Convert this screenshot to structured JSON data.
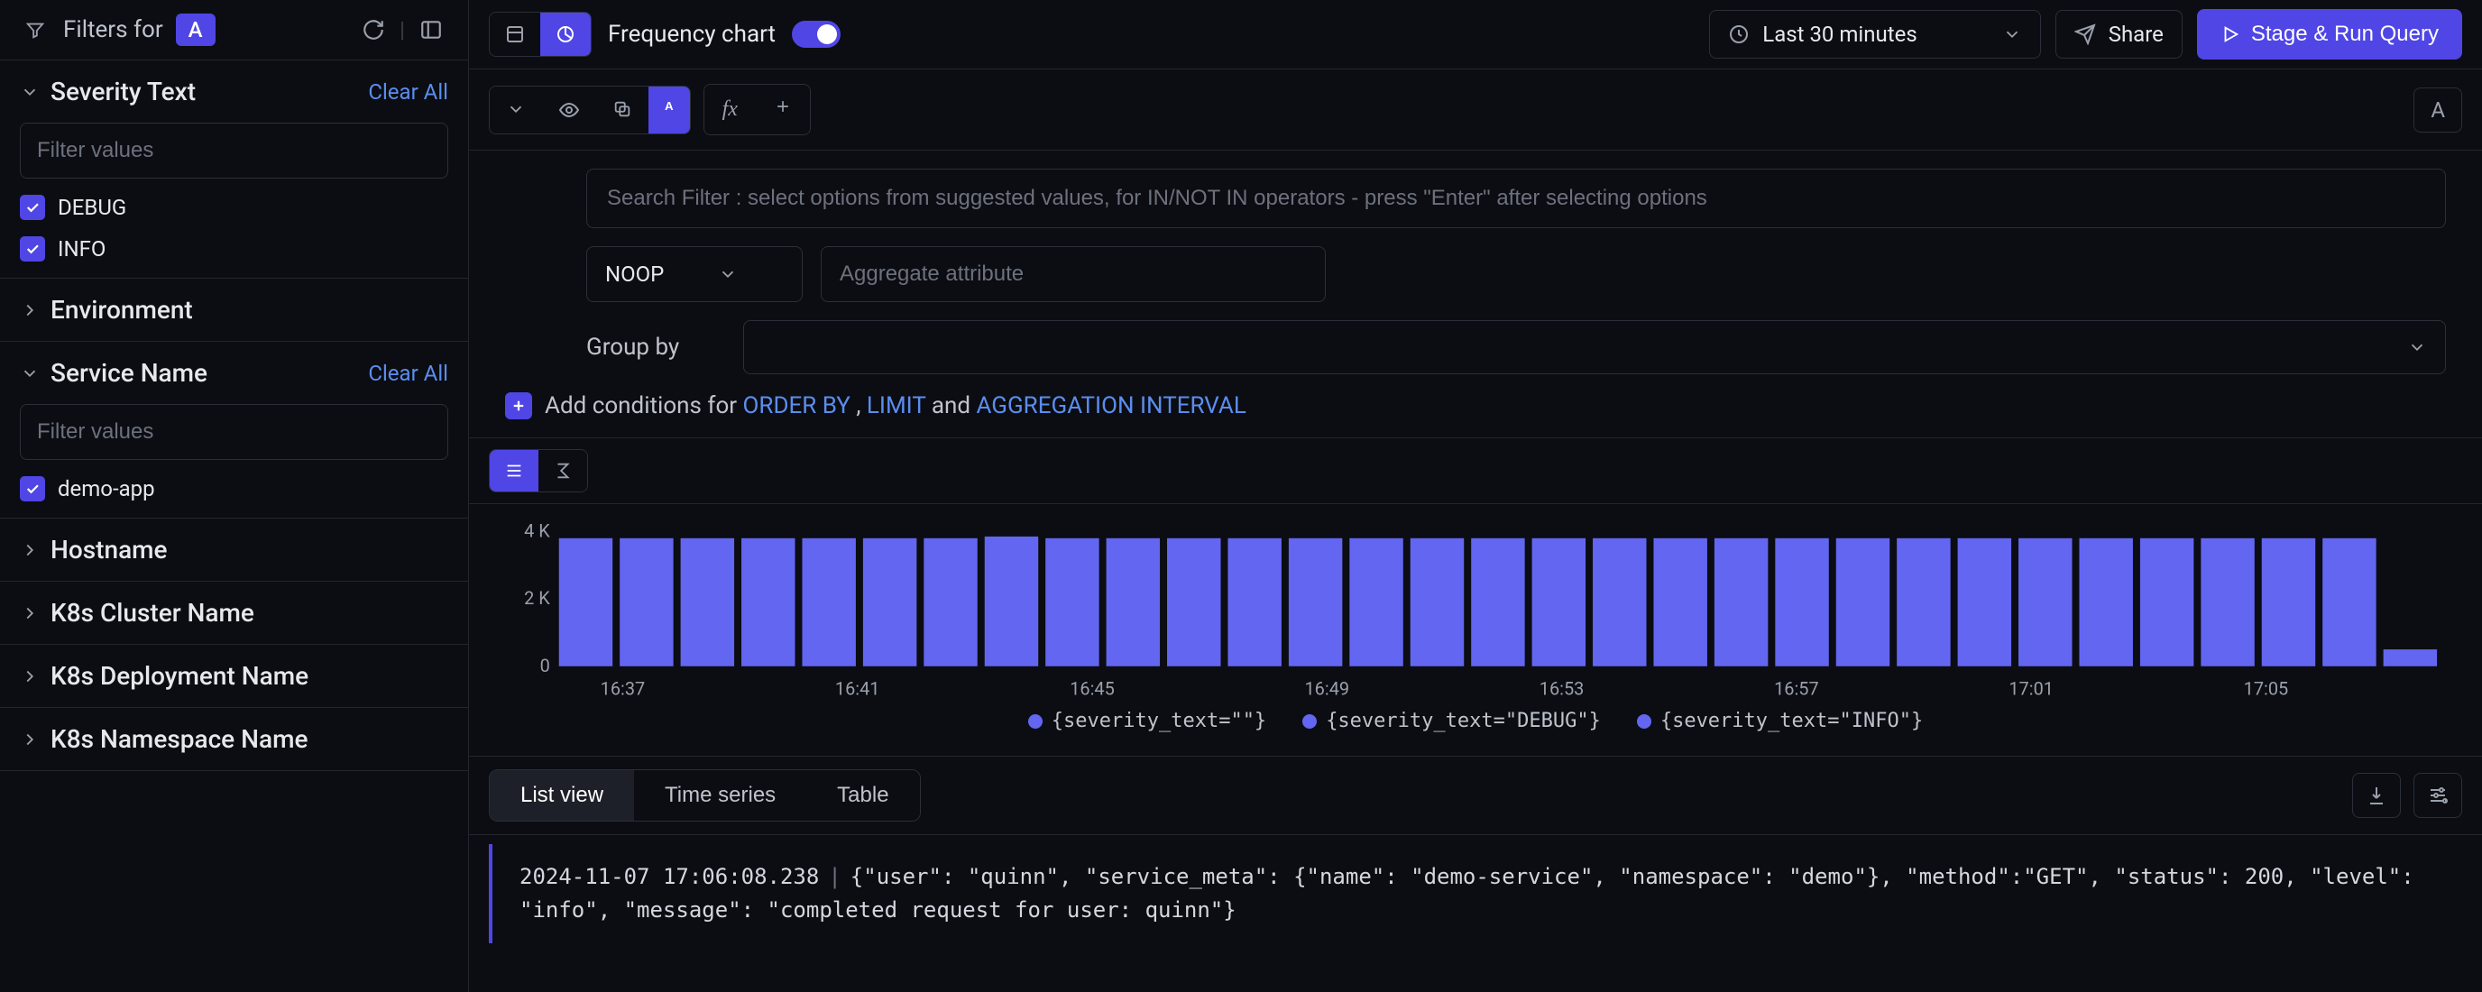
{
  "colors": {
    "accent": "#4f46e5",
    "link": "#5b8def"
  },
  "sidebar": {
    "filters_for": "Filters for",
    "badge": "A",
    "sections": {
      "severity": {
        "title": "Severity Text",
        "clear": "Clear All",
        "filter_placeholder": "Filter values",
        "items": [
          "DEBUG",
          "INFO"
        ]
      },
      "environment": {
        "title": "Environment"
      },
      "service": {
        "title": "Service Name",
        "clear": "Clear All",
        "filter_placeholder": "Filter values",
        "items": [
          "demo-app"
        ]
      },
      "hostname": {
        "title": "Hostname"
      },
      "k8s_cluster": {
        "title": "K8s Cluster Name"
      },
      "k8s_deployment": {
        "title": "K8s Deployment Name"
      },
      "k8s_namespace": {
        "title": "K8s Namespace Name"
      }
    }
  },
  "topbar": {
    "freq_label": "Frequency chart",
    "time_range": "Last 30 minutes",
    "share": "Share",
    "run": "Stage & Run Query"
  },
  "query_row": {
    "badge": "A",
    "fx": "fx",
    "small_a": "A"
  },
  "search": {
    "placeholder": "Search Filter : select options from suggested values, for IN/NOT IN operators - press \"Enter\" after selecting options",
    "noop": "NOOP",
    "agg_placeholder": "Aggregate attribute",
    "groupby_label": "Group by",
    "cond_prefix": "Add conditions for ",
    "cond_order": "ORDER BY",
    "cond_sep1": " , ",
    "cond_limit": "LIMIT",
    "cond_sep2": " and ",
    "cond_agg": "AGGREGATION INTERVAL"
  },
  "chart_data": {
    "type": "bar",
    "ylabel": "",
    "ylim": [
      0,
      4000
    ],
    "yticks": [
      "4 K",
      "2 K",
      "0"
    ],
    "xticks": [
      "16:37",
      "16:41",
      "16:45",
      "16:49",
      "16:53",
      "16:57",
      "17:01",
      "17:05"
    ],
    "bars": [
      3800,
      3800,
      3800,
      3800,
      3800,
      3800,
      3800,
      3850,
      3800,
      3800,
      3800,
      3800,
      3800,
      3800,
      3800,
      3800,
      3800,
      3800,
      3800,
      3800,
      3800,
      3800,
      3800,
      3800,
      3800,
      3800,
      3800,
      3800,
      3800,
      3800,
      500
    ],
    "legend": [
      "{severity_text=\"\"}",
      "{severity_text=\"DEBUG\"}",
      "{severity_text=\"INFO\"}"
    ]
  },
  "views": {
    "tabs": [
      "List view",
      "Time series",
      "Table"
    ],
    "active": 0
  },
  "log": {
    "ts": "2024-11-07 17:06:08.238",
    "body": "{\"user\": \"quinn\", \"service_meta\": {\"name\": \"demo-service\", \"namespace\": \"demo\"}, \"method\":\"GET\", \"status\": 200, \"level\": \"info\", \"message\": \"completed request for user: quinn\"}"
  }
}
